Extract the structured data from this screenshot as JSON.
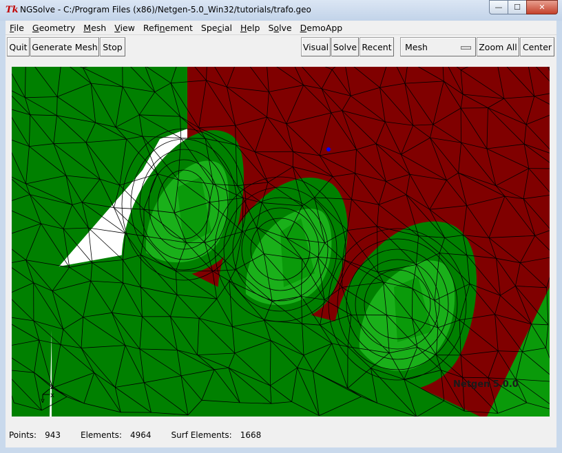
{
  "window": {
    "title": "NGSolve - C:/Program Files (x86)/Netgen-5.0_Win32/tutorials/trafo.geo",
    "app_icon_text": "Tk",
    "controls": {
      "minimize": "—",
      "maximize": "☐",
      "close": "✕"
    }
  },
  "menubar": {
    "items": [
      {
        "pre": "",
        "u": "F",
        "post": "ile"
      },
      {
        "pre": "",
        "u": "G",
        "post": "eometry"
      },
      {
        "pre": "",
        "u": "M",
        "post": "esh"
      },
      {
        "pre": "",
        "u": "V",
        "post": "iew"
      },
      {
        "pre": "Refi",
        "u": "n",
        "post": "ement"
      },
      {
        "pre": "Spe",
        "u": "c",
        "post": "ial"
      },
      {
        "pre": "",
        "u": "H",
        "post": "elp"
      },
      {
        "pre": "S",
        "u": "o",
        "post": "lve"
      },
      {
        "pre": "",
        "u": "D",
        "post": "emoApp"
      }
    ]
  },
  "toolbar": {
    "quit": "Quit",
    "generate_mesh": "Generate Mesh",
    "stop": "Stop",
    "visual": "Visual",
    "solve": "Solve",
    "recent": "Recent",
    "mesh_select": "Mesh",
    "zoom_all": "Zoom All",
    "center": "Center"
  },
  "viewport": {
    "version_label": "Netgen 5.0.0",
    "axes": {
      "z": "z",
      "x": "x",
      "y": "y"
    },
    "colors": {
      "dark_face": "#800000",
      "green_face": "#008000",
      "light_green_face": "#1ab01a",
      "mid_green_face": "#0a9a0a",
      "edges": "#000000",
      "selected_point": "#0000ff"
    }
  },
  "status": {
    "points_label": "Points:",
    "points_value": "943",
    "elements_label": "Elements:",
    "elements_value": "4964",
    "surf_label": "Surf Elements:",
    "surf_value": "1668"
  }
}
